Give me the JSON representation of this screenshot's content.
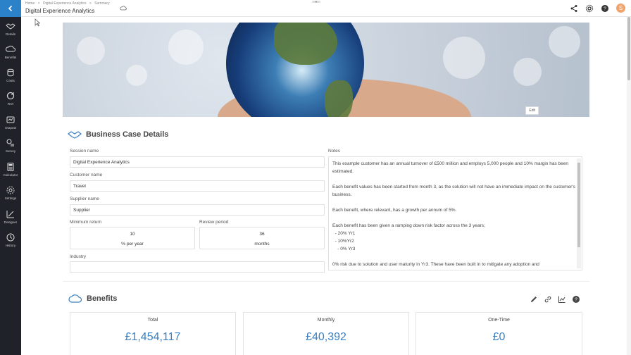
{
  "breadcrumb": [
    "Home",
    "Digital Experience Analytics",
    "Summary"
  ],
  "app_title": "Digital Experience Analytics",
  "avatar_initial": "S",
  "nav": [
    {
      "label": "Details",
      "icon": "handshake-icon"
    },
    {
      "label": "Benefits",
      "icon": "cloud-icon"
    },
    {
      "label": "Costs",
      "icon": "coins-icon"
    },
    {
      "label": "ROI",
      "icon": "refresh-icon"
    },
    {
      "label": "Outputs",
      "icon": "outputs-icon"
    },
    {
      "label": "Survey",
      "icon": "survey-icon"
    },
    {
      "label": "Calculator",
      "icon": "calculator-icon"
    },
    {
      "label": "Settings",
      "icon": "gear-icon"
    },
    {
      "label": "Designer",
      "icon": "designer-icon"
    },
    {
      "label": "History",
      "icon": "history-icon"
    }
  ],
  "hero": {
    "edit_label": "Edit"
  },
  "details": {
    "title": "Business Case Details",
    "session_name_label": "Session name",
    "session_name": "Digital Experience Analytics",
    "customer_name_label": "Customer name",
    "customer_name": "Travel",
    "supplier_name_label": "Supplier name",
    "supplier_name": "Supplier",
    "min_return_label": "Minimum return",
    "min_return_value": "10",
    "min_return_unit": "% per year",
    "review_period_label": "Review period",
    "review_period_value": "36",
    "review_period_unit": "months",
    "industry_label": "Industry",
    "industry": "",
    "notes_label": "Notes",
    "notes_text": "This example customer has an annual turnover of £500 million and employs 5,000 people and 10% margin has been estimated.\n\nEach benefit values has been started from month 3, as the solution will not have an immediate impact on the customer's business.\n\nEach benefit, where relevant, has a growth per annum of 5%.\n\nEach benefit has been given a ramping down risk factor across the 3 years;\n  - 20% Yr1\n  - 10%Yr2\n    - 0% Yr3\n\n0% risk due to solution and user maturity in Yr3. These have been built in to mitigate any adoption and"
  },
  "benefits": {
    "title": "Benefits",
    "cards": [
      {
        "label": "Total",
        "value": "£1,454,117"
      },
      {
        "label": "Monthly",
        "value": "£40,392"
      },
      {
        "label": "One-Time",
        "value": "£0"
      }
    ]
  },
  "colors": {
    "accent": "#2b82c9",
    "value_blue": "#3a7fc1",
    "rail_bg": "#1f2228"
  }
}
